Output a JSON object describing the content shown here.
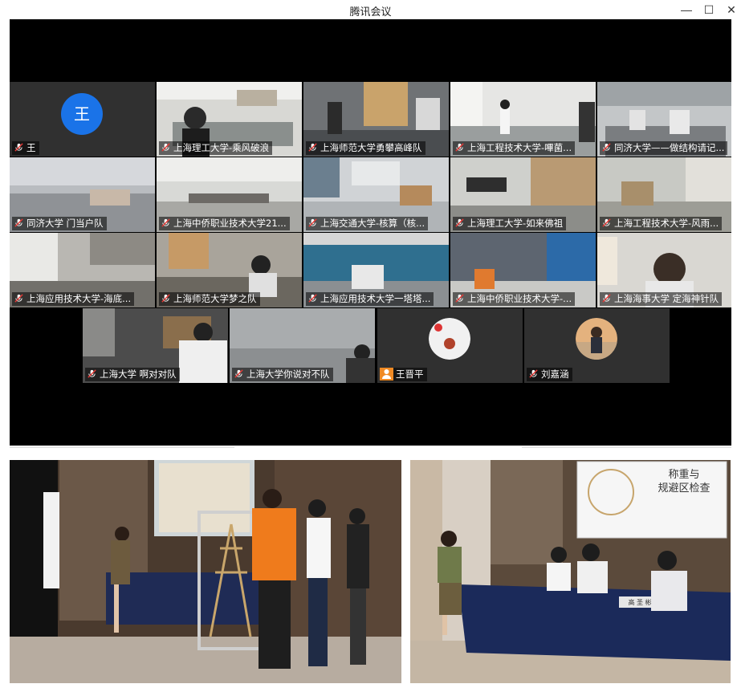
{
  "window": {
    "title": "腾讯会议",
    "minimize_glyph": "—",
    "maximize_glyph": "☐",
    "close_glyph": "✕"
  },
  "participants": [
    {
      "name": "王",
      "type": "avatar",
      "initial": "王"
    },
    {
      "name": "上海理工大学-乘风破浪",
      "type": "video"
    },
    {
      "name": "上海师范大学勇攀高峰队",
      "type": "video"
    },
    {
      "name": "上海工程技术大学-嗶菌...",
      "type": "video"
    },
    {
      "name": "同济大学——做结构请记...",
      "type": "video"
    },
    {
      "name": "同济大学 门当户队",
      "type": "video"
    },
    {
      "name": "上海中侨职业技术大学21...",
      "type": "video"
    },
    {
      "name": "上海交通大学-核算（核...",
      "type": "video"
    },
    {
      "name": "上海理工大学-如来佛祖",
      "type": "video"
    },
    {
      "name": "上海工程技术大学-风雨...",
      "type": "video"
    },
    {
      "name": "上海应用技术大学-海底...",
      "type": "video"
    },
    {
      "name": "上海师范大学梦之队",
      "type": "video"
    },
    {
      "name": "上海应用技术大学一塔塔...",
      "type": "video"
    },
    {
      "name": "上海中侨职业技术大学-...",
      "type": "video"
    },
    {
      "name": "上海海事大学 定海神针队",
      "type": "video"
    },
    {
      "name": "上海大学 啊对对队",
      "type": "video"
    },
    {
      "name": "上海大学你说对不队",
      "type": "video"
    },
    {
      "name": "王晋平",
      "type": "photo-avatar"
    },
    {
      "name": "刘嘉涵",
      "type": "photo-avatar"
    }
  ],
  "photos": {
    "left_caption": "",
    "right_slide_title_line1": "称重与",
    "right_slide_title_line2": "规避区检查",
    "right_nameplate": "高 圣 彬"
  },
  "colors": {
    "meeting_bg": "#000000",
    "tile_bg": "#2b2b2b",
    "avatar_blue": "#1a73e8",
    "badge_orange": "#f08a24"
  }
}
